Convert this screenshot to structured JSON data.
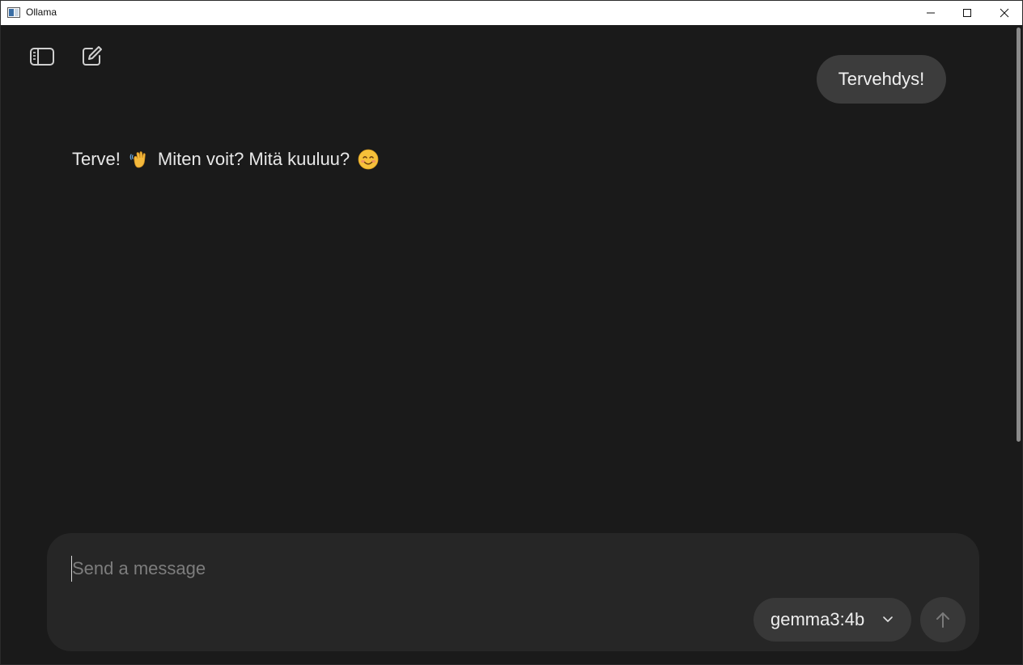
{
  "window": {
    "title": "Ollama",
    "minimize_icon": "minimize-icon",
    "maximize_icon": "maximize-icon",
    "close_icon": "close-icon"
  },
  "toolbar": {
    "sidebar_toggle_icon": "sidebar-toggle-icon",
    "new_chat_icon": "new-chat-icon"
  },
  "messages": {
    "user": "Tervehdys!",
    "assistant_part1": "Terve!",
    "assistant_emoji1": "waving-hand-icon",
    "assistant_part2": "Miten voit? Mitä kuuluu?",
    "assistant_emoji2": "smiling-face-icon"
  },
  "composer": {
    "placeholder": "Send a message",
    "value": "",
    "model": "gemma3:4b",
    "send_icon": "arrow-up-icon"
  },
  "colors": {
    "background": "#1a1a1a",
    "user_bubble": "#3c3c3c",
    "composer": "#262626",
    "pill": "#383838"
  }
}
